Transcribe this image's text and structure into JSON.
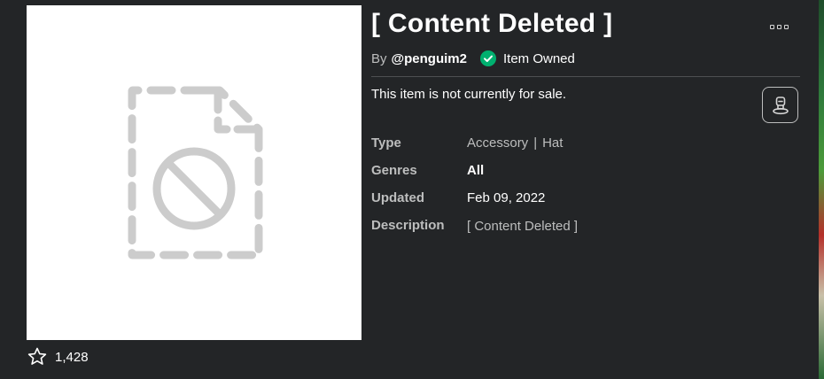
{
  "item": {
    "title": "[ Content Deleted ]",
    "by_label": "By",
    "creator": "@penguim2",
    "owned_label": "Item Owned",
    "sale_status": "This item is not currently for sale.",
    "favorites": "1,428"
  },
  "details": {
    "type_label": "Type",
    "type_primary": "Accessory",
    "type_separator": "|",
    "type_secondary": "Hat",
    "genres_label": "Genres",
    "genres_value": "All",
    "updated_label": "Updated",
    "updated_value": "Feb 09, 2022",
    "description_label": "Description",
    "description_value": "[ Content Deleted ]"
  },
  "icons": {
    "more": "more-options-icon",
    "owned": "checkmark-circle-icon",
    "try_on": "avatar-try-on-icon",
    "favorite": "star-outline-icon",
    "placeholder": "deleted-file-icon"
  },
  "colors": {
    "background": "#232527",
    "owned_green": "#00b06f",
    "placeholder_gray": "#cccccc",
    "muted_text": "#bdbebe"
  }
}
